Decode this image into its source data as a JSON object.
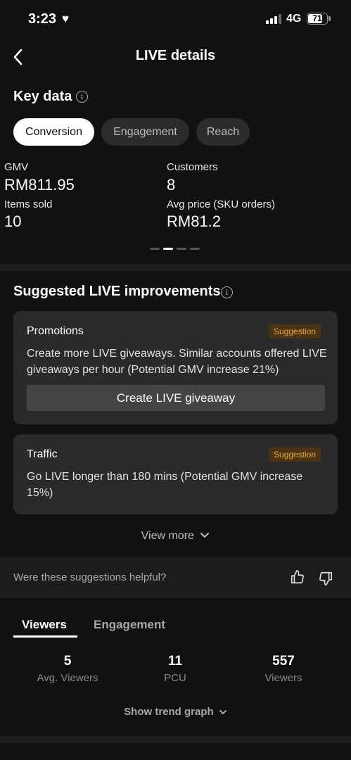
{
  "status_bar": {
    "time": "3:23",
    "network": "4G",
    "battery": "71"
  },
  "header": {
    "title": "LIVE details"
  },
  "key_data": {
    "title": "Key data",
    "tabs": [
      {
        "label": "Conversion",
        "active": true
      },
      {
        "label": "Engagement",
        "active": false
      },
      {
        "label": "Reach",
        "active": false
      }
    ],
    "metrics": [
      {
        "label": "GMV",
        "value": "RM811.95"
      },
      {
        "label": "Customers",
        "value": "8"
      },
      {
        "label": "Items sold",
        "value": "10"
      },
      {
        "label": "Avg price (SKU orders)",
        "value": "RM81.2"
      }
    ],
    "page_indicator": {
      "total": 4,
      "active": 1
    }
  },
  "suggestions": {
    "title": "Suggested LIVE improvements",
    "cards": [
      {
        "title": "Promotions",
        "badge": "Suggestion",
        "text": "Create more LIVE giveaways. Similar accounts offered LIVE giveaways per hour (Potential GMV increase 21%)",
        "button": "Create LIVE giveaway"
      },
      {
        "title": "Traffic",
        "badge": "Suggestion",
        "text": "Go LIVE longer than 180 mins (Potential GMV increase 15%)"
      }
    ],
    "view_more": "View more"
  },
  "feedback": {
    "question": "Were these suggestions helpful?"
  },
  "viewers": {
    "tabs": [
      {
        "label": "Viewers",
        "active": true
      },
      {
        "label": "Engagement",
        "active": false
      }
    ],
    "stats": [
      {
        "value": "5",
        "label": "Avg. Viewers"
      },
      {
        "value": "11",
        "label": "PCU"
      },
      {
        "value": "557",
        "label": "Viewers"
      }
    ],
    "trend_link": "Show trend graph"
  },
  "colors": {
    "background": "#111111",
    "card": "#2a2a2a",
    "badge_text": "#e9a43a",
    "badge_bg": "#4a3413"
  }
}
